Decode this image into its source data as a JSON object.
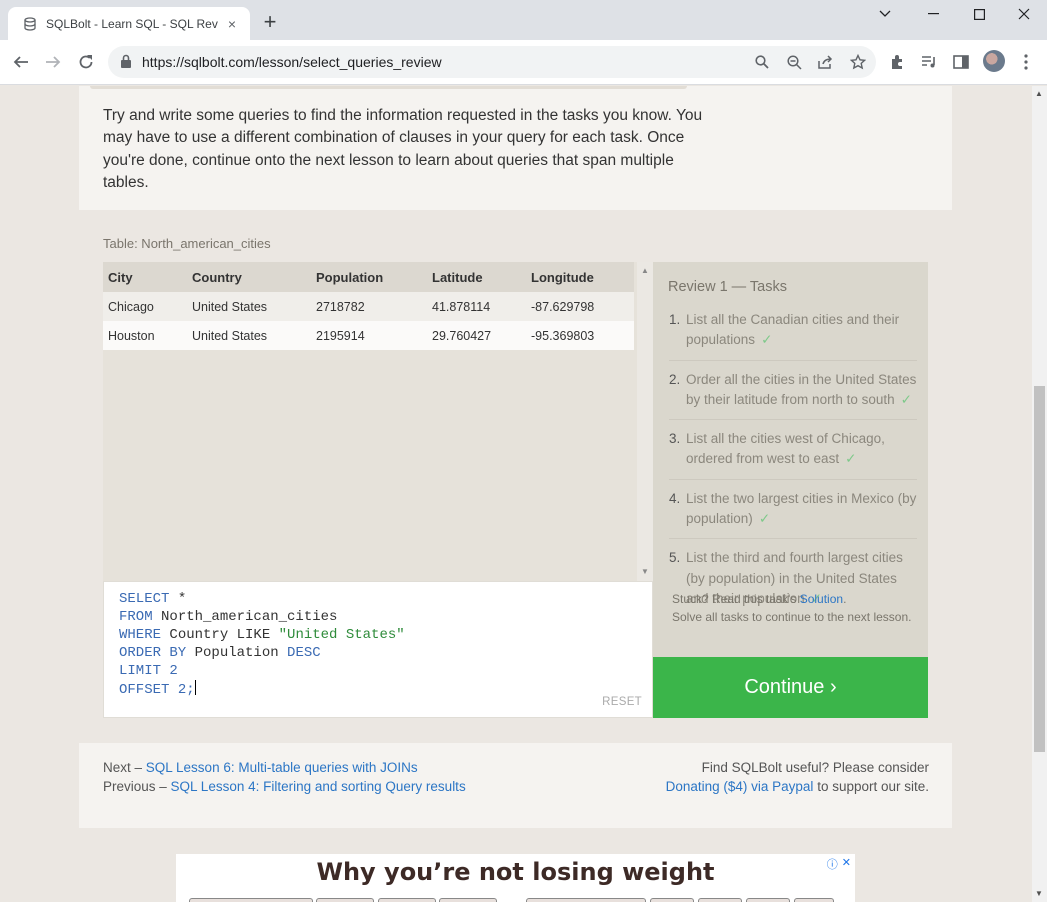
{
  "browser": {
    "tab_title": "SQLBolt - Learn SQL - SQL Review",
    "url": "https://sqlbolt.com/lesson/select_queries_review",
    "new_tab": "+",
    "tab_close": "×"
  },
  "intro": "Try and write some queries to find the information requested in the tasks you know. You may have to use a different combination of clauses in your query for each task. Once you're done, continue onto the next lesson to learn about queries that span multiple tables.",
  "table": {
    "label": "Table: North_american_cities",
    "columns": [
      "City",
      "Country",
      "Population",
      "Latitude",
      "Longitude"
    ],
    "rows": [
      [
        "Chicago",
        "United States",
        "2718782",
        "41.878114",
        "-87.629798"
      ],
      [
        "Houston",
        "United States",
        "2195914",
        "29.760427",
        "-95.369803"
      ]
    ]
  },
  "editor": {
    "lines": [
      [
        "SELECT",
        " *"
      ],
      [
        "FROM",
        " North_american_cities"
      ],
      [
        "WHERE",
        " Country LIKE ",
        "\"United States\""
      ],
      [
        "ORDER BY",
        " Population ",
        "DESC"
      ],
      [
        "LIMIT",
        " 2"
      ],
      [
        "OFFSET",
        " 2;"
      ]
    ],
    "reset_label": "RESET"
  },
  "tasks": {
    "title": "Review 1 — Tasks",
    "items": [
      {
        "num": "1.",
        "text": "List all the Canadian cities and their populations"
      },
      {
        "num": "2.",
        "text": "Order all the cities in the United States by their latitude from north to south"
      },
      {
        "num": "3.",
        "text": "List all the cities west of Chicago, ordered from west to east"
      },
      {
        "num": "4.",
        "text": "List the two largest cities in Mexico (by population)"
      },
      {
        "num": "5.",
        "text": "List the third and fourth largest cities (by population) in the United States and their population"
      }
    ],
    "check": "✓",
    "stuck_prefix": "Stuck? Read this task's ",
    "stuck_link": "Solution",
    "stuck_suffix": ".",
    "solve_note": "Solve all tasks to continue to the next lesson.",
    "continue_label": "Continue ›"
  },
  "footer": {
    "next_prefix": "Next – ",
    "next_link": "SQL Lesson 6: Multi-table queries with JOINs",
    "prev_prefix": "Previous – ",
    "prev_link": "SQL Lesson 4: Filtering and sorting Query results",
    "useful_text": "Find SQLBolt useful? Please consider",
    "donate_link": "Donating ($4) via Paypal",
    "donate_suffix": " to support our site."
  },
  "ad": {
    "headline": "Why you’re not losing weight",
    "info": "ⓘ",
    "close": "✕"
  },
  "colors": {
    "continue_button": "#3bb54a",
    "link": "#2c76c5",
    "check": "#7ec98a"
  }
}
